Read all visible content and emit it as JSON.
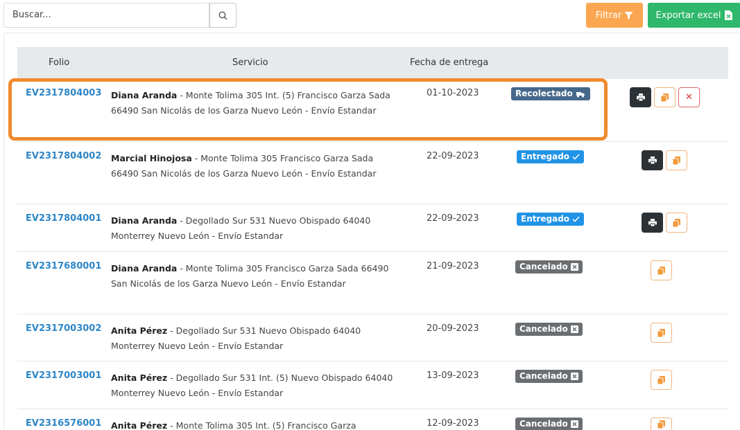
{
  "toolbar": {
    "search_placeholder": "Buscar...",
    "filter_label": "Filtrar",
    "export_label": "Exportar excel"
  },
  "table": {
    "headers": [
      "Folio",
      "Servicio",
      "Fecha de entrega"
    ],
    "rows": [
      {
        "folio": "EV2317804003",
        "name": "Diana Aranda",
        "address": " - Monte Tolima 305 Int. (5) Francisco Garza Sada 66490 San Nicolás de los Garza Nuevo León - Envío Estandar",
        "fecha": "01-10-2023",
        "status": "Recolectado",
        "status_icon": "truck-check-icon",
        "actions": [
          "print",
          "copy",
          "delete"
        ]
      },
      {
        "folio": "EV2317804002",
        "name": "Marcial Hinojosa",
        "address": " - Monte Tolima 305 Francisco Garza Sada 66490 San Nicolás de los Garza Nuevo León - Envío Estandar",
        "fecha": "22-09-2023",
        "status": "Entregado",
        "status_icon": "check-icon",
        "actions": [
          "print",
          "copy"
        ]
      },
      {
        "folio": "EV2317804001",
        "name": "Diana Aranda",
        "address": " - Degollado Sur 531 Nuevo Obispado 64040 Monterrey Nuevo León - Envío Estandar",
        "fecha": "22-09-2023",
        "status": "Entregado",
        "status_icon": "check-icon",
        "actions": [
          "print",
          "copy"
        ]
      },
      {
        "folio": "EV2317680001",
        "name": "Diana Aranda",
        "address": " - Monte Tolima 305 Francisco Garza Sada 66490 San Nicolás de los Garza Nuevo León - Envío Estandar",
        "fecha": "21-09-2023",
        "status": "Cancelado",
        "status_icon": "x-square-icon",
        "actions": [
          "copy"
        ]
      },
      {
        "folio": "EV2317003002",
        "name": "Anita Pérez",
        "address": " - Degollado Sur 531 Nuevo Obispado 64040 Monterrey Nuevo León - Envío Estandar",
        "fecha": "20-09-2023",
        "status": "Cancelado",
        "status_icon": "x-square-icon",
        "actions": [
          "copy"
        ]
      },
      {
        "folio": "EV2317003001",
        "name": "Anita Pérez",
        "address": " - Degollado Sur 531 Int. (5) Nuevo Obispado 64040 Monterrey Nuevo León - Envío Estandar",
        "fecha": "13-09-2023",
        "status": "Cancelado",
        "status_icon": "x-square-icon",
        "actions": [
          "copy"
        ]
      },
      {
        "folio": "EV2316576001",
        "name": "Anita Pérez",
        "address": " - Monte Tolima 305 Int. (5) Francisco Garza",
        "fecha": "12-09-2023",
        "status": "Cancelado",
        "status_icon": "x-square-icon",
        "actions": [
          "copy"
        ]
      }
    ]
  },
  "colors": {
    "filter": "#fba751",
    "export": "#2fb86b",
    "link": "#2e86c7",
    "recolectado": "#46698b",
    "entregado": "#2093e6",
    "cancelado": "#6b6e71",
    "highlight": "#ef8a2c"
  }
}
